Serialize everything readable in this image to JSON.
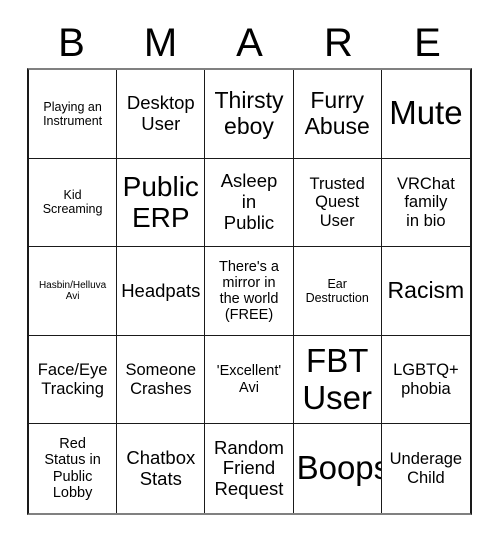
{
  "card": {
    "title_letters": [
      "B",
      "M",
      "A",
      "R",
      "E"
    ],
    "size": "5x5",
    "rows": [
      [
        {
          "text": "Playing an\nInstrument",
          "scale": "fs-xs"
        },
        {
          "text": "Desktop\nUser",
          "scale": "fs-l"
        },
        {
          "text": "Thirsty\neboy",
          "scale": "fs-xl"
        },
        {
          "text": "Furry\nAbuse",
          "scale": "fs-xl"
        },
        {
          "text": "Mute",
          "scale": "fs-huge"
        }
      ],
      [
        {
          "text": "Kid\nScreaming",
          "scale": "fs-xs"
        },
        {
          "text": "Public\nERP",
          "scale": "fs-xxl"
        },
        {
          "text": "Asleep\nin\nPublic",
          "scale": "fs-l"
        },
        {
          "text": "Trusted\nQuest\nUser",
          "scale": "fs-m"
        },
        {
          "text": "VRChat\nfamily\nin bio",
          "scale": "fs-m"
        }
      ],
      [
        {
          "text": "Hasbin/Helluva\nAvi",
          "scale": "fs-xxs"
        },
        {
          "text": "Headpats",
          "scale": "fs-l"
        },
        {
          "text": "There's a\nmirror in\nthe world\n(FREE)",
          "scale": "fs-s"
        },
        {
          "text": "Ear\nDestruction",
          "scale": "fs-xs"
        },
        {
          "text": "Racism",
          "scale": "fs-xl"
        }
      ],
      [
        {
          "text": "Face/Eye\nTracking",
          "scale": "fs-m"
        },
        {
          "text": "Someone\nCrashes",
          "scale": "fs-m"
        },
        {
          "text": "'Excellent'\nAvi",
          "scale": "fs-s"
        },
        {
          "text": "FBT\nUser",
          "scale": "fs-huge"
        },
        {
          "text": "LGBTQ+\nphobia",
          "scale": "fs-m"
        }
      ],
      [
        {
          "text": "Red\nStatus in\nPublic\nLobby",
          "scale": "fs-s"
        },
        {
          "text": "Chatbox\nStats",
          "scale": "fs-l"
        },
        {
          "text": "Random\nFriend\nRequest",
          "scale": "fs-l"
        },
        {
          "text": "Boops",
          "scale": "fs-huge"
        },
        {
          "text": "Underage\nChild",
          "scale": "fs-m"
        }
      ]
    ]
  },
  "colors": {
    "background": "#ffffff",
    "text": "#000000",
    "grid_line": "#1a1a1a",
    "outer_border": "#808080"
  }
}
